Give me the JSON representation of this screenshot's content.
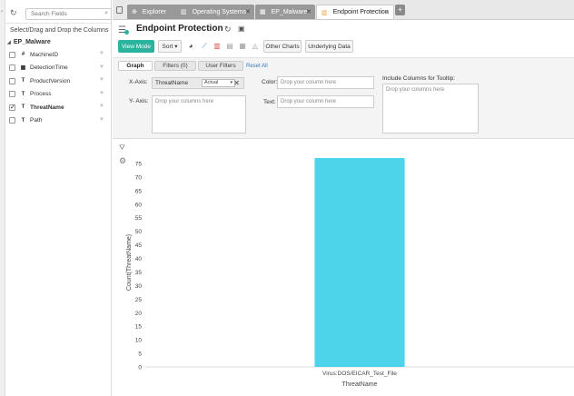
{
  "sidebar": {
    "search_placeholder": "Search Fields",
    "hint": "Select/Drag and Drop the Columns",
    "dataset": "EP_Malware",
    "fields": [
      {
        "name": "MachineID",
        "type": "#",
        "checked": false
      },
      {
        "name": "DetectionTime",
        "type": "cal",
        "checked": false
      },
      {
        "name": "ProductVersion",
        "type": "T",
        "checked": false
      },
      {
        "name": "Process",
        "type": "T",
        "checked": false
      },
      {
        "name": "ThreatName",
        "type": "T",
        "checked": true
      },
      {
        "name": "Path",
        "type": "T",
        "checked": false
      }
    ]
  },
  "tabs": [
    {
      "label": "Explorer"
    },
    {
      "label": "Operating Systems"
    },
    {
      "label": "EP_Malware"
    },
    {
      "label": "Endpoint Protection"
    }
  ],
  "header": {
    "title": "Endpoint Protection"
  },
  "toolbar": {
    "view_mode": "View Mode",
    "sort": "Sort",
    "other_charts": "Other Charts",
    "underlying_data": "Underlying Data"
  },
  "config": {
    "tab_graph": "Graph",
    "tab_filters": "Filters (0)",
    "tab_user_filters": "User Filters",
    "reset_all": "Reset All",
    "x_axis_label": "X-Axis:",
    "x_axis_value": "ThreatName",
    "x_axis_agg": "Actual",
    "y_axis_label": "Y- Axis:",
    "y_axis_placeholder": "Drop your columns here",
    "color_label": "Color:",
    "color_placeholder": "Drop your column here",
    "text_label": "Text:",
    "text_placeholder": "Drop your column here",
    "tooltip_label": "Include Columns for Tooltip:",
    "tooltip_placeholder": "Drop your columns here"
  },
  "chart_data": {
    "type": "bar",
    "categories": [
      "Virus:DOS/EICAR_Test_File"
    ],
    "values": [
      77
    ],
    "xlabel": "ThreatName",
    "ylabel": "Count(ThreatName)",
    "ylim": [
      0,
      77
    ],
    "yticks": [
      0,
      5,
      10,
      15,
      20,
      25,
      30,
      35,
      40,
      45,
      50,
      55,
      60,
      65,
      70,
      75
    ],
    "grid": false,
    "bar_color": "#4dd3ea"
  },
  "colors": {
    "accent": "#2ab49f",
    "tab_inactive": "#999999"
  }
}
